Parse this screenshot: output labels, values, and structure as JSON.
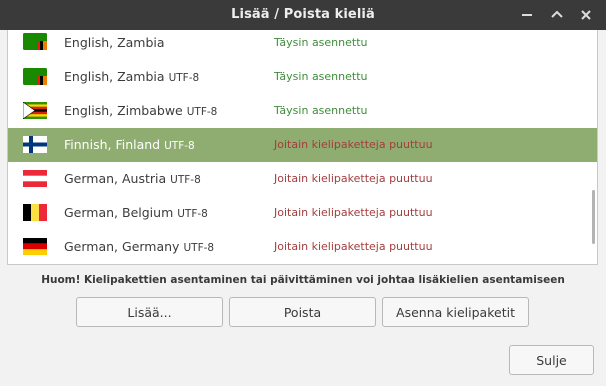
{
  "window": {
    "title": "Lisää / Poista kieliä"
  },
  "languages": [
    {
      "name": "English, Zambia",
      "encoding": "",
      "status": "Täysin asennettu",
      "state": "ok",
      "flag": "zambia-flag-icon"
    },
    {
      "name": "English, Zambia",
      "encoding": "UTF-8",
      "status": "Täysin asennettu",
      "state": "ok",
      "flag": "zambia-flag-icon"
    },
    {
      "name": "English, Zimbabwe",
      "encoding": "UTF-8",
      "status": "Täysin asennettu",
      "state": "ok",
      "flag": "zimbabwe-flag-icon"
    },
    {
      "name": "Finnish, Finland",
      "encoding": "UTF-8",
      "status": "Joitain kielipaketteja puuttuu",
      "state": "missing",
      "flag": "finland-flag-icon",
      "selected": true
    },
    {
      "name": "German, Austria",
      "encoding": "UTF-8",
      "status": "Joitain kielipaketteja puuttuu",
      "state": "missing",
      "flag": "austria-flag-icon"
    },
    {
      "name": "German, Belgium",
      "encoding": "UTF-8",
      "status": "Joitain kielipaketteja puuttuu",
      "state": "missing",
      "flag": "belgium-flag-icon"
    },
    {
      "name": "German, Germany",
      "encoding": "UTF-8",
      "status": "Joitain kielipaketteja puuttuu",
      "state": "missing",
      "flag": "germany-flag-icon"
    }
  ],
  "notice": "Huom! Kielipakettien asentaminen tai päivittäminen voi johtaa lisäkielien asentamiseen",
  "buttons": {
    "add": "Lisää...",
    "remove": "Poista",
    "install": "Asenna kielipaketit",
    "close": "Sulje"
  },
  "colors": {
    "selection": "#8fad70",
    "installed": "#3f8c3a",
    "missing": "#a33d3d"
  }
}
